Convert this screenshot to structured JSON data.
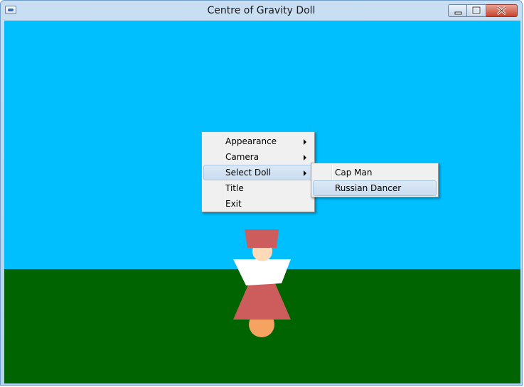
{
  "window": {
    "title": "Centre of Gravity Doll",
    "icon": "app-icon"
  },
  "titlebar_controls": [
    "minimize-icon",
    "maximize-icon",
    "close-icon"
  ],
  "scene": {
    "sky_color": "#00bfff",
    "ground_color": "#006400",
    "doll_colors": {
      "hat": "#cd5c5c",
      "face": "#ffdab9",
      "collar": "#ffffff",
      "dress": "#cd5c5c",
      "base": "#f4a460"
    }
  },
  "context_menu": {
    "items": [
      {
        "label": "Appearance",
        "has_submenu": true
      },
      {
        "label": "Camera",
        "has_submenu": true
      },
      {
        "label": "Select Doll",
        "has_submenu": true,
        "highlighted": true
      },
      {
        "label": "Title",
        "has_submenu": false
      },
      {
        "label": "Exit",
        "has_submenu": false
      }
    ]
  },
  "submenu": {
    "items": [
      {
        "label": "Cap Man"
      },
      {
        "label": "Russian Dancer",
        "highlighted": true
      }
    ]
  }
}
